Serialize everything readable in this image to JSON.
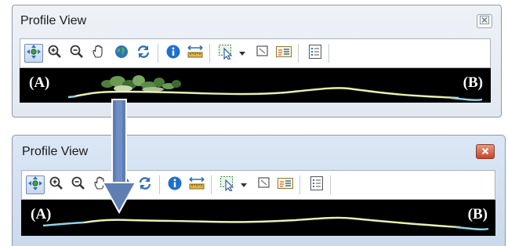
{
  "windows": [
    {
      "title": "Profile View",
      "label_a": "(A)",
      "label_b": "(B)",
      "close_icon": "close-icon",
      "toolbar_icons": [
        "pan-navigate-icon",
        "zoom-in-icon",
        "zoom-out-icon",
        "hand-pan-icon",
        "globe-full-extent-icon",
        "refresh-icon",
        "info-icon",
        "measure-icon",
        "select-icon",
        "dropdown-icon",
        "clear-selection-icon",
        "export-icon",
        "properties-icon"
      ],
      "vegetation_visible": true
    },
    {
      "title": "Profile View",
      "label_a": "(A)",
      "label_b": "(B)",
      "close_icon": "close-icon",
      "toolbar_icons": [
        "pan-navigate-icon",
        "zoom-in-icon",
        "zoom-out-icon",
        "hand-pan-icon",
        "globe-full-extent-icon",
        "refresh-icon",
        "info-icon",
        "measure-icon",
        "select-icon",
        "dropdown-icon",
        "clear-selection-icon",
        "export-icon",
        "properties-icon"
      ],
      "vegetation_visible": false
    }
  ],
  "colors": {
    "ground_profile": "#e8f0b0",
    "water_profile": "#8fd4e8",
    "vegetation": "#5f8a4a",
    "arrow": "#5f7fb4",
    "close_active": "#c6452c"
  }
}
